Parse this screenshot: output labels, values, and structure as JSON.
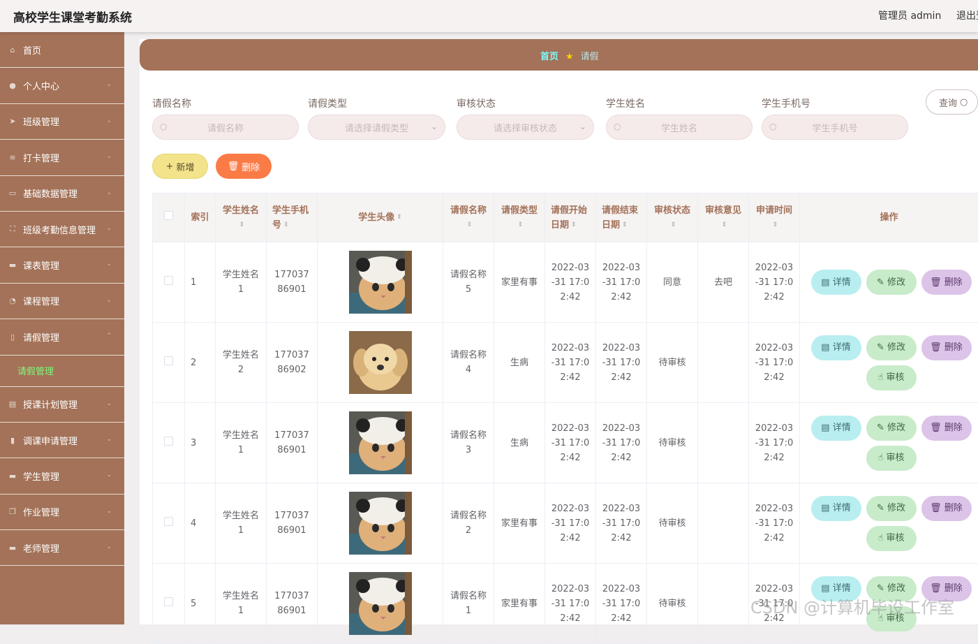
{
  "header": {
    "title": "高校学生课堂考勤系统",
    "admin": "管理员 admin",
    "logout": "退出登录"
  },
  "sidebar": {
    "items": [
      {
        "label": "首页",
        "icon": "home-icon",
        "glyph": "⌂",
        "chev": ""
      },
      {
        "label": "个人中心",
        "icon": "user-icon",
        "glyph": "●",
        "chev": "⌄"
      },
      {
        "label": "班级管理",
        "icon": "send-icon",
        "glyph": "➤",
        "chev": "⌄"
      },
      {
        "label": "打卡管理",
        "icon": "list-icon",
        "glyph": "≡",
        "chev": "⌄"
      },
      {
        "label": "基础数据管理",
        "icon": "message-icon",
        "glyph": "▭",
        "chev": "⌄"
      },
      {
        "label": "班级考勤信息管理",
        "icon": "frame-icon",
        "glyph": "⛶",
        "chev": "⌄"
      },
      {
        "label": "课表管理",
        "icon": "briefcase-icon",
        "glyph": "▬",
        "chev": "⌄"
      },
      {
        "label": "课程管理",
        "icon": "power-icon",
        "glyph": "◔",
        "chev": "⌄"
      },
      {
        "label": "请假管理",
        "icon": "phone-icon",
        "glyph": "▯",
        "chev": "⌃"
      }
    ],
    "sub_active": "请假管理",
    "items2": [
      {
        "label": "授课计划管理",
        "icon": "document-icon",
        "glyph": "▤",
        "chev": "⌄"
      },
      {
        "label": "调课申请管理",
        "icon": "chart-icon",
        "glyph": "▮",
        "chev": "⌄"
      },
      {
        "label": "学生管理",
        "icon": "monitor-icon",
        "glyph": "▬",
        "chev": "⌄"
      },
      {
        "label": "作业管理",
        "icon": "copy-icon",
        "glyph": "❐",
        "chev": "⌄"
      },
      {
        "label": "老师管理",
        "icon": "car-icon",
        "glyph": "▬",
        "chev": "⌄"
      }
    ]
  },
  "breadcrumb": {
    "home": "首页",
    "current": "请假"
  },
  "filters": {
    "name_label": "请假名称",
    "name_placeholder": "请假名称",
    "type_label": "请假类型",
    "type_placeholder": "请选择请假类型",
    "status_label": "审核状态",
    "status_placeholder": "请选择审核状态",
    "student_label": "学生姓名",
    "student_placeholder": "学生姓名",
    "phone_label": "学生手机号",
    "phone_placeholder": "学生手机号",
    "query": "查询"
  },
  "actions": {
    "add": "新增",
    "delete": "删除"
  },
  "table": {
    "columns": [
      "索引",
      "学生姓名",
      "学生手机号",
      "学生头像",
      "请假名称",
      "请假类型",
      "请假开始日期",
      "请假结束日期",
      "审核状态",
      "审核意见",
      "申请时间",
      "操作"
    ],
    "ops": {
      "detail": "详情",
      "edit": "修改",
      "delete": "删除",
      "audit": "审核"
    },
    "rows": [
      {
        "idx": "1",
        "student": "学生姓名1",
        "phone": "17703786901",
        "avatar": "cat",
        "name": "请假名称5",
        "type": "家里有事",
        "start": "2022-03-31 17:02:42",
        "end": "2022-03-31 17:02:42",
        "status": "同意",
        "opinion": "去吧",
        "applied": "2022-03-31 17:02:42",
        "audit": false
      },
      {
        "idx": "2",
        "student": "学生姓名2",
        "phone": "17703786902",
        "avatar": "dog",
        "name": "请假名称4",
        "type": "生病",
        "start": "2022-03-31 17:02:42",
        "end": "2022-03-31 17:02:42",
        "status": "待审核",
        "opinion": "",
        "applied": "2022-03-31 17:02:42",
        "audit": true
      },
      {
        "idx": "3",
        "student": "学生姓名1",
        "phone": "17703786901",
        "avatar": "cat",
        "name": "请假名称3",
        "type": "生病",
        "start": "2022-03-31 17:02:42",
        "end": "2022-03-31 17:02:42",
        "status": "待审核",
        "opinion": "",
        "applied": "2022-03-31 17:02:42",
        "audit": true
      },
      {
        "idx": "4",
        "student": "学生姓名1",
        "phone": "17703786901",
        "avatar": "cat",
        "name": "请假名称2",
        "type": "家里有事",
        "start": "2022-03-31 17:02:42",
        "end": "2022-03-31 17:02:42",
        "status": "待审核",
        "opinion": "",
        "applied": "2022-03-31 17:02:42",
        "audit": true
      },
      {
        "idx": "5",
        "student": "学生姓名1",
        "phone": "17703786901",
        "avatar": "cat",
        "name": "请假名称1",
        "type": "家里有事",
        "start": "2022-03-31 17:02:42",
        "end": "2022-03-31 17:02:42",
        "status": "待审核",
        "opinion": "",
        "applied": "2022-03-31 17:02:42",
        "audit": true
      }
    ]
  },
  "watermark": "CSDN @计算机毕设工作室"
}
